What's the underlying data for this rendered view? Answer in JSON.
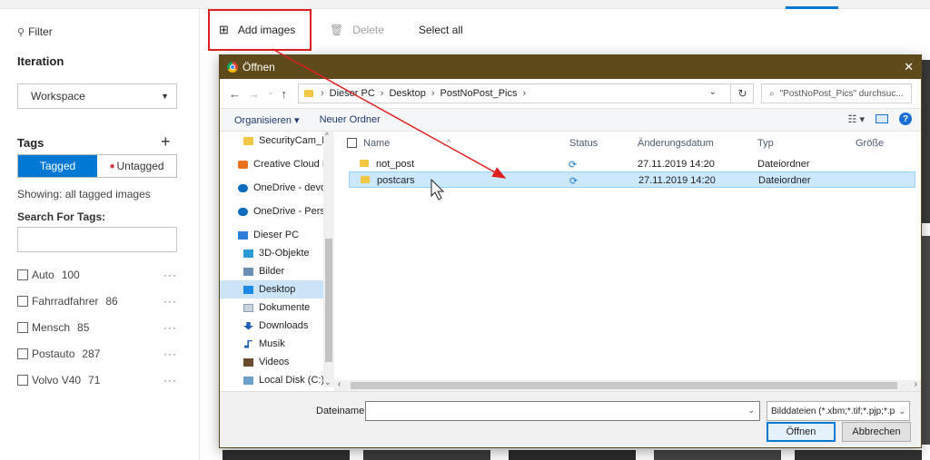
{
  "sidebar": {
    "filter_label": "Filter",
    "iteration_title": "Iteration",
    "iteration_value": "Workspace",
    "tags_title": "Tags",
    "tagged_label": "Tagged",
    "untagged_label": "Untagged",
    "showing_text": "Showing: all tagged images",
    "search_label": "Search For Tags:",
    "search_value": "",
    "tags": [
      {
        "name": "Auto",
        "count": "100"
      },
      {
        "name": "Fahrradfahrer",
        "count": "86"
      },
      {
        "name": "Mensch",
        "count": "85"
      },
      {
        "name": "Postauto",
        "count": "287"
      },
      {
        "name": "Volvo V40",
        "count": "71"
      }
    ],
    "more": "···"
  },
  "toolbar": {
    "add_images_label": "Add images",
    "delete_label": "Delete",
    "select_all_label": "Select all"
  },
  "dialog": {
    "title": "Öffnen",
    "close": "✕",
    "path": [
      "Dieser PC",
      "Desktop",
      "PostNoPost_Pics"
    ],
    "search_placeholder": "\"PostNoPost_Pics\" durchsuc...",
    "organize_label": "Organisieren ▾",
    "new_folder_label": "Neuer Ordner",
    "nav_items": [
      {
        "label": "SecurityCam_Int",
        "icon": "folder"
      },
      {
        "label": "Creative Cloud Fil",
        "icon": "cc"
      },
      {
        "label": "OneDrive - devote",
        "icon": "cloud"
      },
      {
        "label": "OneDrive - Person",
        "icon": "cloud"
      },
      {
        "label": "Dieser PC",
        "icon": "pc"
      },
      {
        "label": "3D-Objekte",
        "icon": "obj"
      },
      {
        "label": "Bilder",
        "icon": "pic"
      },
      {
        "label": "Desktop",
        "icon": "desk"
      },
      {
        "label": "Dokumente",
        "icon": "doc"
      },
      {
        "label": "Downloads",
        "icon": "dl"
      },
      {
        "label": "Musik",
        "icon": "music"
      },
      {
        "label": "Videos",
        "icon": "vid"
      },
      {
        "label": "Local Disk (C:)",
        "icon": "disk"
      }
    ],
    "columns": {
      "name": "Name",
      "status": "Status",
      "date": "Änderungsdatum",
      "type": "Typ",
      "size": "Größe"
    },
    "files": [
      {
        "name": "not_post",
        "status": "⟳",
        "date": "27.11.2019 14:20",
        "type": "Dateiordner",
        "size": ""
      },
      {
        "name": "postcars",
        "status": "⟳",
        "date": "27.11.2019 14:20",
        "type": "Dateiordner",
        "size": ""
      }
    ],
    "filename_label": "Dateiname:",
    "filename_value": "",
    "filetype_value": "Bilddateien (*.xbm;*.tif;*.pjp;*.p",
    "open_label": "Öffnen",
    "cancel_label": "Abbrechen"
  },
  "colors": {
    "accent": "#0078d4",
    "highlight_box": "#e02020",
    "titlebar": "#5e4a1a",
    "untagged_dot": "#d13438"
  }
}
